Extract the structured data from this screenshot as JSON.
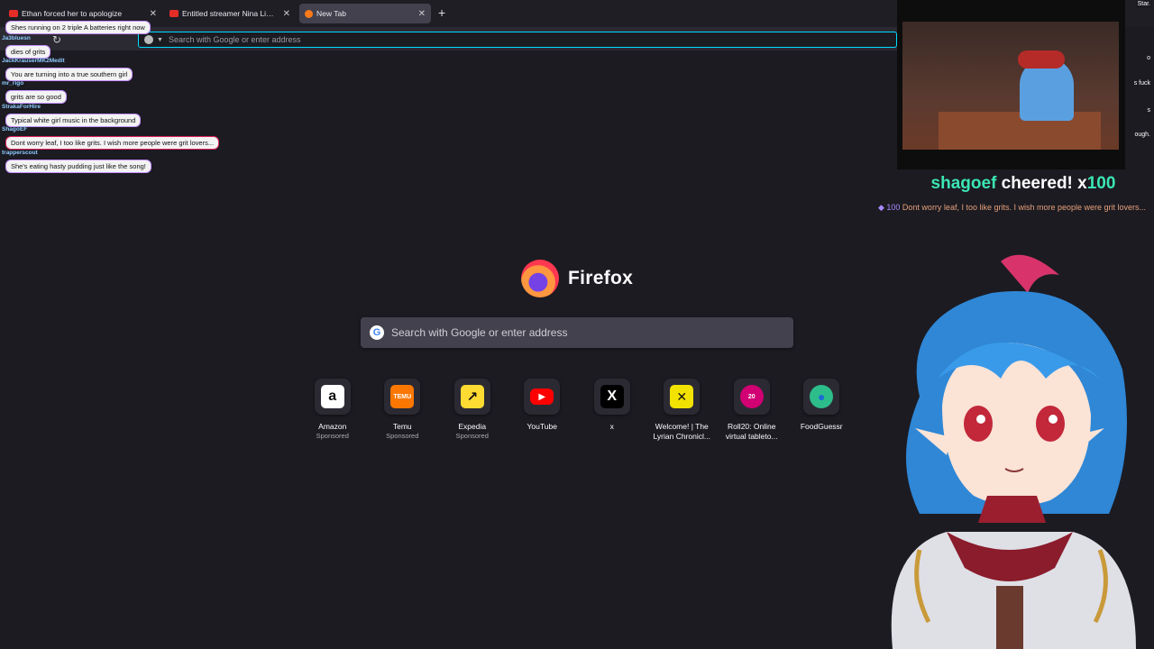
{
  "tabs": [
    {
      "title": "Ethan forced her to apologize",
      "active": false
    },
    {
      "title": "Entitled streamer Nina Lin finall",
      "active": false
    },
    {
      "title": "New Tab",
      "active": true
    }
  ],
  "urlbar": {
    "placeholder": "Search with Google or enter address"
  },
  "newtab": {
    "brand": "Firefox",
    "search_placeholder": "Search with Google or enter address",
    "tiles": [
      {
        "title": "Amazon",
        "sub": "Sponsored",
        "icon": "amazon-icon",
        "color": "#ffffff",
        "glyph": "a"
      },
      {
        "title": "Temu",
        "sub": "Sponsored",
        "icon": "temu-icon",
        "color": "#fb7701",
        "glyph": "TEMU"
      },
      {
        "title": "Expedia",
        "sub": "Sponsored",
        "icon": "expedia-icon",
        "color": "#fddb32",
        "glyph": "↗"
      },
      {
        "title": "YouTube",
        "sub": "",
        "icon": "youtube-icon",
        "color": "#ff0000",
        "glyph": "▶"
      },
      {
        "title": "x",
        "sub": "",
        "icon": "x-icon",
        "color": "#000000",
        "glyph": "𝕏"
      },
      {
        "title": "Welcome! | The Lyrian Chronicl...",
        "sub": "",
        "icon": "lyrian-icon",
        "color": "#f2e200",
        "glyph": "✕"
      },
      {
        "title": "Roll20: Online virtual tableto...",
        "sub": "",
        "icon": "roll20-icon",
        "color": "#d10073",
        "glyph": "20"
      },
      {
        "title": "FoodGuessr",
        "sub": "",
        "icon": "foodguessr-icon",
        "color": "#2dbd8a",
        "glyph": "●"
      }
    ]
  },
  "chat": [
    {
      "user": "",
      "text": "Shes running on 2 triple A batteries right now"
    },
    {
      "user": "Ja3bluesn",
      "text": "dies of grits"
    },
    {
      "user": "JackKrauserMK2Medit",
      "text": "You are turning into a true southern girl"
    },
    {
      "user": "mr_rigo",
      "text": "grits are so good"
    },
    {
      "user": "StrakaForHire",
      "text": "Typical white girl music in the background"
    },
    {
      "user": "ShagoEF",
      "text": "Dont worry leaf, I too like grits. I wish more people were grit lovers..."
    },
    {
      "user": "trapperscout",
      "text": "She's eating hasty pudding just like the song!"
    }
  ],
  "side_strip": [
    "Star.",
    "o",
    "s fuck",
    "s",
    "ough."
  ],
  "cheer": {
    "name": "shagoef",
    "middle": " cheered! x",
    "amount": "100",
    "bits": "100",
    "message": " Dont worry leaf, I too like grits. I wish more people were grit lovers..."
  }
}
